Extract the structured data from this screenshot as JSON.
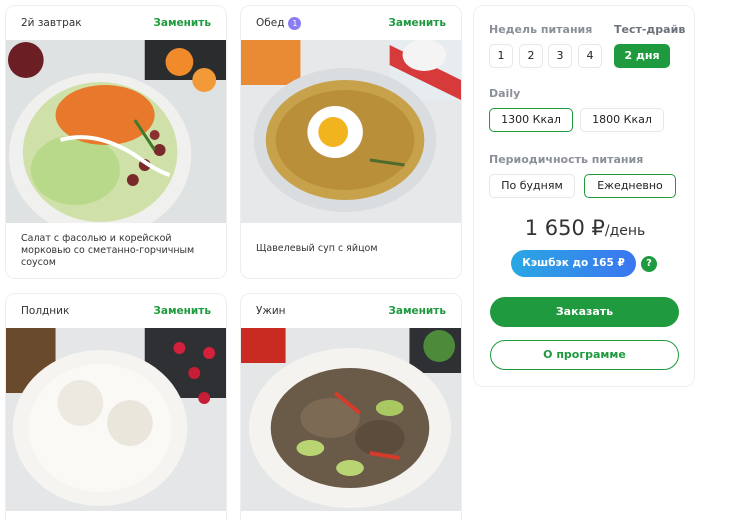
{
  "meals": [
    {
      "name": "2й завтрак",
      "replace": "Заменить",
      "desc": "Салат с фасолью и корейской морковью со сметанно-горчичным соусом"
    },
    {
      "name": "Обед",
      "badge": "1",
      "replace": "Заменить",
      "desc": "Щавелевый суп с яйцом"
    },
    {
      "name": "Полдник",
      "replace": "Заменить"
    },
    {
      "name": "Ужин",
      "replace": "Заменить"
    }
  ],
  "panel": {
    "weeks_label": "Недель питания",
    "weeks": [
      "1",
      "2",
      "3",
      "4"
    ],
    "trial_label": "Тест-драйв",
    "trial_button": "2 дня",
    "daily_label": "Daily",
    "kcal": [
      "1300 Ккал",
      "1800 Ккал"
    ],
    "period_label": "Периодичность питания",
    "period": [
      "По будням",
      "Ежедневно"
    ],
    "price": "1 650 ₽",
    "per_day": "/день",
    "cashback": "Кэшбэк до 165 ₽",
    "help": "?",
    "order": "Заказать",
    "about": "О программе"
  },
  "colors": {
    "accent": "#1f9a3f",
    "badge": "#8a7cf2",
    "cashback_from": "#2aa7e3",
    "cashback_to": "#3b76f0"
  }
}
